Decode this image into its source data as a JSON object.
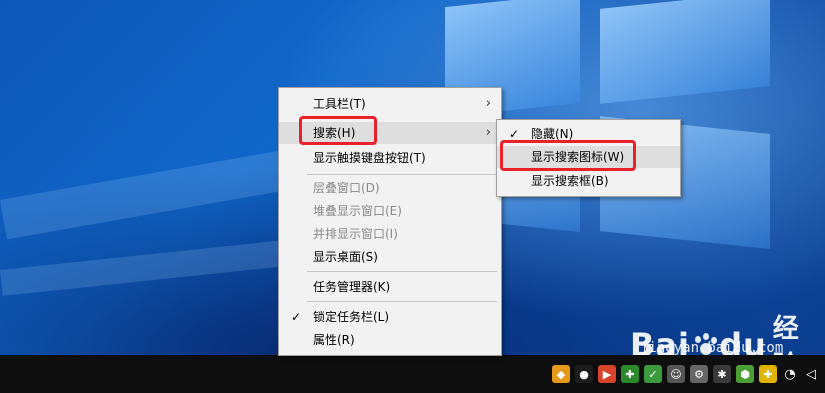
{
  "context_menu": {
    "items": [
      {
        "label": "工具栏(T)",
        "has_submenu": true
      },
      {
        "label": "搜索(H)",
        "has_submenu": true,
        "active": true
      },
      {
        "label": "显示触摸键盘按钮(T)"
      },
      {
        "label": "层叠窗口(D)",
        "disabled": true
      },
      {
        "label": "堆叠显示窗口(E)",
        "disabled": true
      },
      {
        "label": "并排显示窗口(I)",
        "disabled": true
      },
      {
        "label": "显示桌面(S)"
      },
      {
        "label": "任务管理器(K)"
      },
      {
        "label": "锁定任务栏(L)",
        "checked": true
      },
      {
        "label": "属性(R)"
      }
    ]
  },
  "search_submenu": {
    "items": [
      {
        "label": "隐藏(N)",
        "checked": true
      },
      {
        "label": "显示搜索图标(W)",
        "hovered": true
      },
      {
        "label": "显示搜索框(B)"
      }
    ]
  },
  "glyphs": {
    "check": "✓",
    "arrow": "›"
  },
  "watermark": {
    "logo_a": "Bai",
    "logo_b": "du",
    "cn": "经验",
    "url": "jingyan.baidu.com"
  },
  "taskbar": {
    "tray_icons": [
      "security-shield-icon",
      "qq-icon",
      "media-icon",
      "antivirus-icon",
      "shield-check-icon",
      "user-icon",
      "settings-gear-icon",
      "update-icon",
      "network-guard-icon",
      "wifi-icon",
      "volume-icon"
    ]
  },
  "colors": {
    "highlight": "#e8222a",
    "menu_bg": "#f2f2f2",
    "hover_bg": "#dedede",
    "taskbar": "#0e0e0e"
  }
}
